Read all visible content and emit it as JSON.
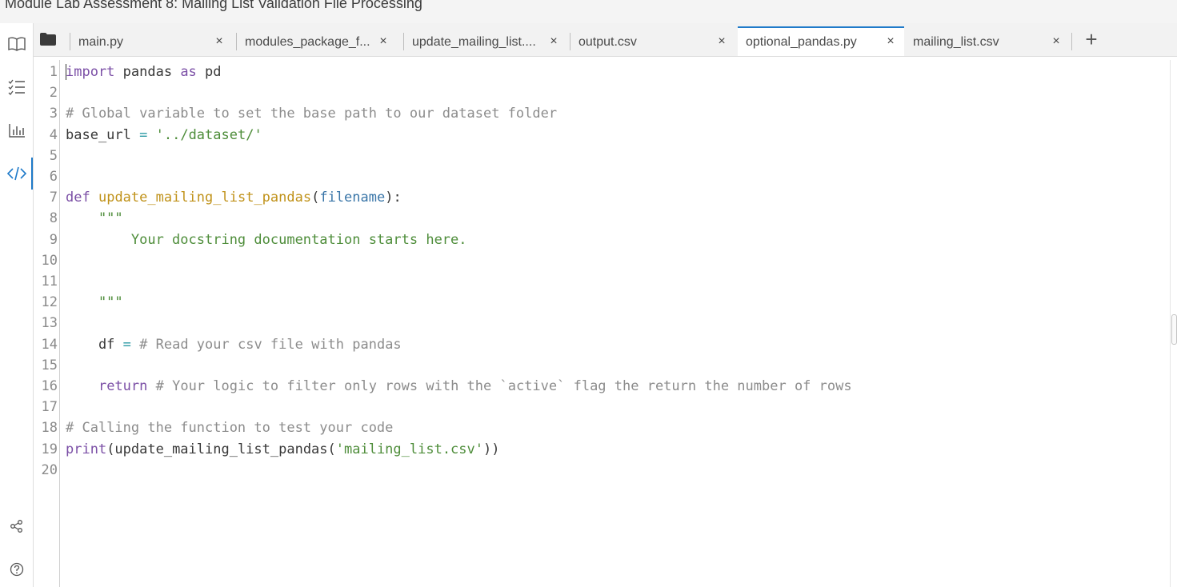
{
  "window": {
    "title": "Module Lab Assessment 8: Mailing List Validation File Processing"
  },
  "left_rail": {
    "icons": [
      "book-icon",
      "checklist-icon",
      "bar-chart-icon",
      "code-icon",
      "share-icon",
      "help-icon"
    ],
    "active": "code-icon",
    "accent_color": "#1f7ac9"
  },
  "tabs": [
    {
      "label": "main.py",
      "close": "×"
    },
    {
      "label": "modules_package_f...",
      "close": "×"
    },
    {
      "label": "update_mailing_list....",
      "close": "×"
    },
    {
      "label": "output.csv",
      "close": "×"
    },
    {
      "label": "optional_pandas.py",
      "close": "×",
      "active": true
    },
    {
      "label": "mailing_list.csv",
      "close": "×"
    }
  ],
  "add_tab_label": "+",
  "editor": {
    "line_numbers": [
      "1",
      "2",
      "3",
      "4",
      "5",
      "6",
      "7",
      "8",
      "9",
      "10",
      "11",
      "12",
      "13",
      "14",
      "15",
      "16",
      "17",
      "18",
      "19",
      "20"
    ],
    "lines": [
      [
        [
          "kw",
          "import"
        ],
        [
          "plain",
          " pandas "
        ],
        [
          "kw",
          "as"
        ],
        [
          "plain",
          " pd"
        ]
      ],
      [],
      [
        [
          "cm",
          "# Global variable to set the base path to our dataset folder"
        ]
      ],
      [
        [
          "plain",
          "base_url "
        ],
        [
          "op",
          "="
        ],
        [
          "plain",
          " "
        ],
        [
          "str",
          "'../dataset/'"
        ]
      ],
      [],
      [],
      [
        [
          "kw",
          "def"
        ],
        [
          "plain",
          " "
        ],
        [
          "fn",
          "update_mailing_list_pandas"
        ],
        [
          "plain",
          "("
        ],
        [
          "param",
          "filename"
        ],
        [
          "plain",
          "):"
        ]
      ],
      [
        [
          "str",
          "    \"\"\""
        ]
      ],
      [
        [
          "str",
          "        Your docstring documentation starts here."
        ]
      ],
      [],
      [],
      [
        [
          "str",
          "    \"\"\""
        ]
      ],
      [],
      [
        [
          "plain",
          "    df "
        ],
        [
          "op",
          "="
        ],
        [
          "plain",
          " "
        ],
        [
          "cm",
          "# Read your csv file with pandas"
        ]
      ],
      [],
      [
        [
          "plain",
          "    "
        ],
        [
          "kw",
          "return"
        ],
        [
          "plain",
          " "
        ],
        [
          "cm",
          "# Your logic to filter only rows with the `active` flag the return the number of rows"
        ]
      ],
      [],
      [
        [
          "cm",
          "# Calling the function to test your code"
        ]
      ],
      [
        [
          "kw",
          "print"
        ],
        [
          "plain",
          "(update_mailing_list_pandas("
        ],
        [
          "str",
          "'mailing_list.csv'"
        ],
        [
          "plain",
          "))"
        ]
      ],
      []
    ]
  },
  "colors": {
    "keyword": "#7b4fa6",
    "function_name": "#c0921a",
    "string": "#4e8d3a",
    "comment": "#8c8c8c",
    "parameter": "#3a76a8",
    "operator": "#2b9aa4"
  }
}
